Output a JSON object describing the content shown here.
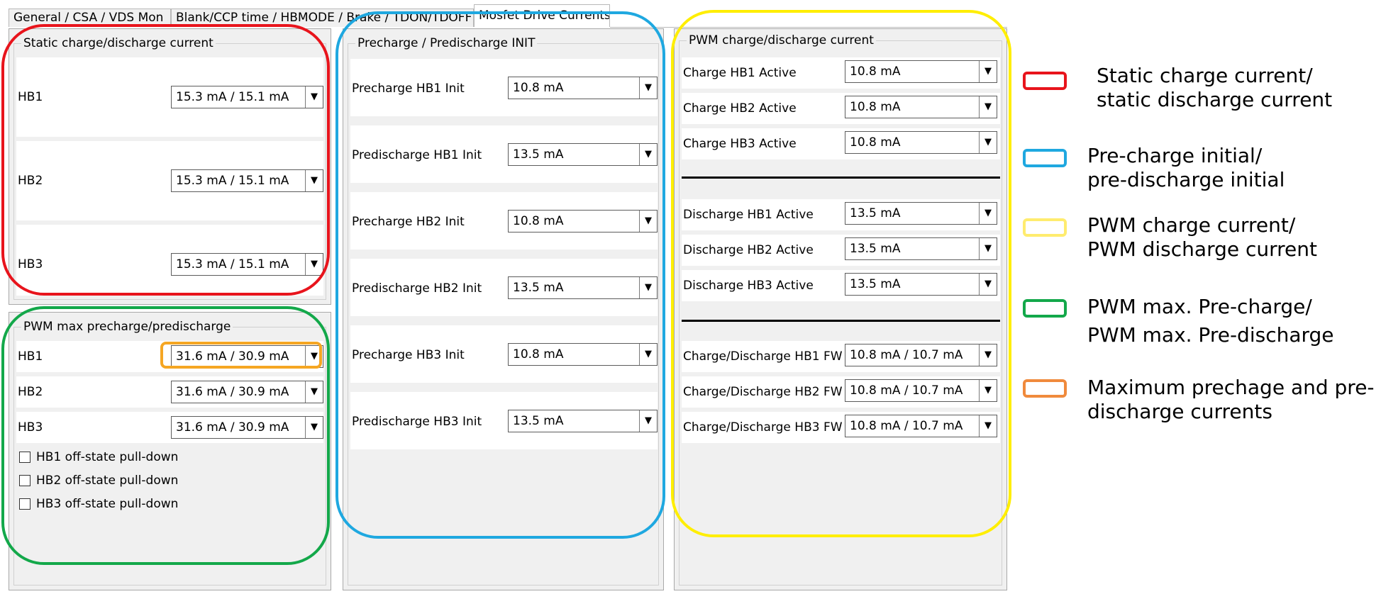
{
  "tabs": [
    "General / CSA / VDS Mon",
    "Blank/CCP time / HBMODE / Brake / TDON/TDOFF",
    "Mosfet Drive Currents"
  ],
  "static": {
    "title": "Static charge/discharge current",
    "rows": [
      {
        "label": "HB1",
        "value": "15.3 mA / 15.1 mA"
      },
      {
        "label": "HB2",
        "value": "15.3 mA / 15.1 mA"
      },
      {
        "label": "HB3",
        "value": "15.3 mA / 15.1 mA"
      }
    ]
  },
  "pwmmax": {
    "title": "PWM max precharge/predischarge",
    "rows": [
      {
        "label": "HB1",
        "value": "31.6 mA / 30.9 mA"
      },
      {
        "label": "HB2",
        "value": "31.6 mA / 30.9 mA"
      },
      {
        "label": "HB3",
        "value": "31.6 mA / 30.9 mA"
      }
    ],
    "checks": [
      "HB1 off-state pull-down",
      "HB2 off-state pull-down",
      "HB3 off-state pull-down"
    ]
  },
  "precharge": {
    "title": "Precharge / Predischarge INIT",
    "rows": [
      {
        "label": "Precharge HB1 Init",
        "value": "10.8 mA"
      },
      {
        "label": "Predischarge HB1 Init",
        "value": "13.5 mA"
      },
      {
        "label": "Precharge HB2 Init",
        "value": "10.8 mA"
      },
      {
        "label": "Predischarge HB2 Init",
        "value": "13.5 mA"
      },
      {
        "label": "Precharge HB3 Init",
        "value": "10.8 mA"
      },
      {
        "label": "Predischarge HB3 Init",
        "value": "13.5 mA"
      }
    ]
  },
  "pwm": {
    "title": "PWM charge/discharge current",
    "charge": [
      {
        "label": "Charge HB1 Active",
        "value": "10.8 mA"
      },
      {
        "label": "Charge HB2 Active",
        "value": "10.8 mA"
      },
      {
        "label": "Charge HB3 Active",
        "value": "10.8 mA"
      }
    ],
    "discharge": [
      {
        "label": "Discharge HB1 Active",
        "value": "13.5 mA"
      },
      {
        "label": "Discharge HB2 Active",
        "value": "13.5 mA"
      },
      {
        "label": "Discharge HB3 Active",
        "value": "13.5 mA"
      }
    ],
    "fw": [
      {
        "label": "Charge/Discharge HB1 FW",
        "value": "10.8 mA / 10.7 mA"
      },
      {
        "label": "Charge/Discharge HB2 FW",
        "value": "10.8 mA / 10.7 mA"
      },
      {
        "label": "Charge/Discharge HB3 FW",
        "value": "10.8 mA / 10.7 mA"
      }
    ]
  },
  "legend": [
    {
      "color": "#e8141c",
      "line1": "Static charge current/",
      "line2": "static discharge current"
    },
    {
      "color": "#1fa8e0",
      "line1": "Pre-charge initial/",
      "line2": "pre-discharge initial"
    },
    {
      "color": "#ffec6e",
      "line1": "PWM charge current/",
      "line2": "PWM discharge current"
    },
    {
      "color": "#13a84a",
      "line1": "PWM max. Pre-charge/",
      "line2": "PWM max. Pre-discharge"
    },
    {
      "color": "#f08a3c",
      "line1": "Maximum prechage and pre-",
      "line2": "discharge currents"
    }
  ],
  "annotation_colors": {
    "red": "#e8141c",
    "blue": "#1fa8e0",
    "yellow": "#ffee00",
    "green": "#13a84a",
    "orange": "#f5a623"
  },
  "icons": {
    "dropdown": "▼"
  }
}
